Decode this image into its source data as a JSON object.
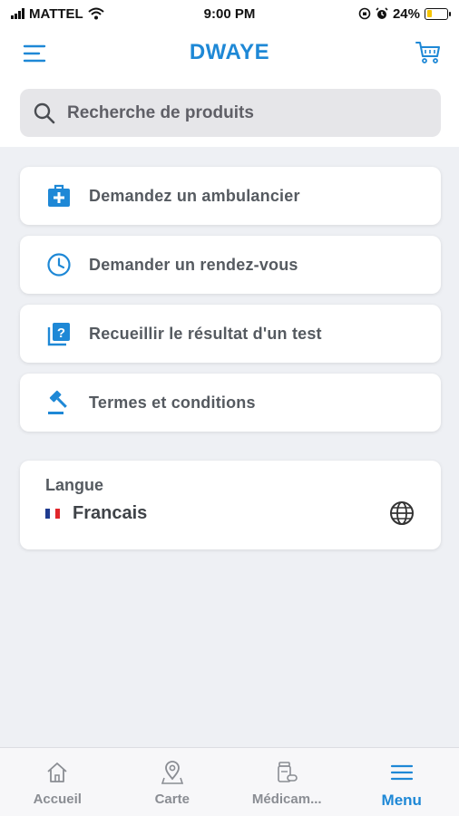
{
  "status_bar": {
    "carrier": "MATTEL",
    "time": "9:00 PM",
    "battery_text": "24%",
    "battery_level": 0.24
  },
  "header": {
    "title": "DWAYE",
    "menu_icon": "hamburger-menu-icon",
    "cart_icon": "shopping-cart-icon"
  },
  "search": {
    "placeholder": "Recherche de produits",
    "value": ""
  },
  "menu_items": [
    {
      "label": "Demandez un ambulancier",
      "icon": "first-aid-kit-icon"
    },
    {
      "label": "Demander un rendez-vous",
      "icon": "clock-icon"
    },
    {
      "label": "Recueillir le résultat d'un test",
      "icon": "question-document-icon"
    },
    {
      "label": "Termes et conditions",
      "icon": "gavel-icon"
    }
  ],
  "language": {
    "title": "Langue",
    "value": "Francais",
    "flag": "france-flag",
    "icon": "globe-icon"
  },
  "tabs": [
    {
      "label": "Accueil",
      "icon": "home-icon",
      "active": false
    },
    {
      "label": "Carte",
      "icon": "map-pin-icon",
      "active": false
    },
    {
      "label": "Médicam...",
      "icon": "medicine-bottle-icon",
      "active": false
    },
    {
      "label": "Menu",
      "icon": "menu-icon",
      "active": true
    }
  ],
  "colors": {
    "accent": "#1e88d6",
    "background": "#eef0f4",
    "text_gray": "#555a60",
    "tab_inactive": "#8a8d93",
    "battery": "#f5c400"
  }
}
